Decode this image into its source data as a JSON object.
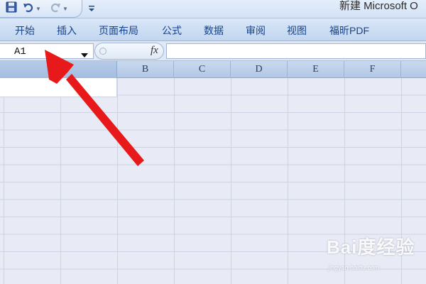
{
  "window": {
    "title": "新建 Microsoft O"
  },
  "quick_access": {
    "icons": [
      "save-icon",
      "undo-icon",
      "redo-icon",
      "customize-qat-icon"
    ]
  },
  "ribbon": {
    "tabs": [
      {
        "label": "开始"
      },
      {
        "label": "插入"
      },
      {
        "label": "页面布局"
      },
      {
        "label": "公式"
      },
      {
        "label": "数据"
      },
      {
        "label": "审阅"
      },
      {
        "label": "视图"
      },
      {
        "label": "福昕PDF"
      }
    ]
  },
  "formula_bar": {
    "name_box_value": "A1",
    "fx_label": "fx",
    "formula_value": ""
  },
  "grid": {
    "column_headers": [
      "B",
      "C",
      "D",
      "E",
      "F"
    ],
    "selected_cell": "A1"
  },
  "annotation": {
    "color": "#e8191a",
    "points_to": "name-box"
  },
  "watermark": {
    "text": "Bai度经验",
    "url": "jingyan.baidu.com"
  },
  "colors": {
    "ribbon_text": "#15428b",
    "sheet_background": "#e8ebf5",
    "header_background": "#b3c8e6"
  }
}
